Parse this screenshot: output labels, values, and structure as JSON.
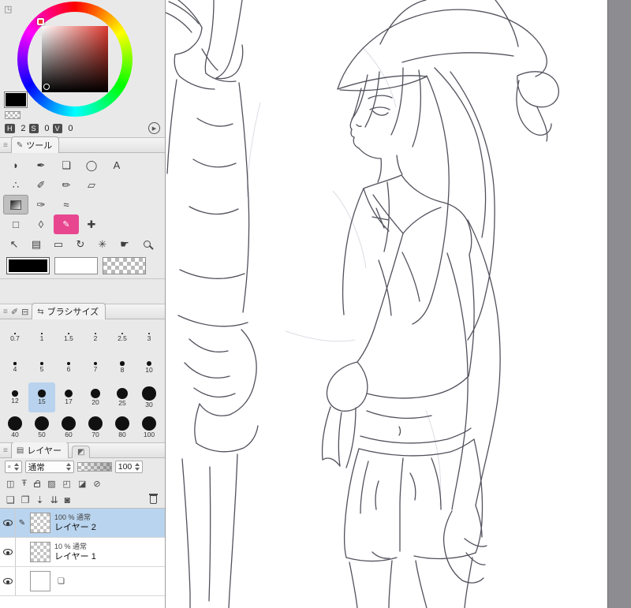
{
  "colors": {
    "accent_pink": "#e8468f",
    "selection_blue": "#b9d3ee",
    "panel_bg": "#e9e9e9",
    "canvas_stroke": "#43434f",
    "right_strip": "#8c8c91",
    "foreground_color": "#000000",
    "background_color": "#ffffff",
    "picked_hue": "#e8372b"
  },
  "color_panel": {
    "hue_label": "H",
    "hue_value": "2",
    "sat_label": "S",
    "sat_value": "0",
    "val_label": "V",
    "val_value": "0"
  },
  "tool_panel": {
    "tab_label": "ツール",
    "tools": [
      {
        "name": "blob-brush",
        "glyph": "◗"
      },
      {
        "name": "dip-pen",
        "glyph": "✒"
      },
      {
        "name": "balloon",
        "glyph": "❏"
      },
      {
        "name": "ellipse-select",
        "glyph": "◯"
      },
      {
        "name": "text",
        "glyph": "A"
      },
      {
        "name": "airbrush",
        "glyph": "∴"
      },
      {
        "name": "marker",
        "glyph": "✐"
      },
      {
        "name": "pencil",
        "glyph": "✏"
      },
      {
        "name": "eraser",
        "glyph": "▱"
      },
      {
        "name": "gradient",
        "glyph": ""
      },
      {
        "name": "brush",
        "glyph": "✑"
      },
      {
        "name": "blend",
        "glyph": "≈"
      },
      {
        "name": "figure",
        "glyph": "□"
      },
      {
        "name": "droplet",
        "glyph": "◊"
      },
      {
        "name": "decoration",
        "glyph": "✎"
      },
      {
        "name": "move",
        "glyph": "✚"
      },
      {
        "name": "object",
        "glyph": "↖"
      },
      {
        "name": "gradient-map",
        "glyph": "▤"
      },
      {
        "name": "canvas-size",
        "glyph": "▭"
      },
      {
        "name": "rotate",
        "glyph": "↻"
      },
      {
        "name": "sparkle",
        "glyph": "✳"
      },
      {
        "name": "hand",
        "glyph": "☛"
      },
      {
        "name": "zoom",
        "glyph": ""
      }
    ]
  },
  "brush_panel": {
    "tab_label": "ブラシサイズ",
    "selected_index": 13,
    "sizes": [
      {
        "label": "0.7",
        "value": 0.7
      },
      {
        "label": "1",
        "value": 1
      },
      {
        "label": "1.5",
        "value": 1.5
      },
      {
        "label": "2",
        "value": 2
      },
      {
        "label": "2.5",
        "value": 2.5
      },
      {
        "label": "3",
        "value": 3
      },
      {
        "label": "4",
        "value": 4
      },
      {
        "label": "5",
        "value": 5
      },
      {
        "label": "6",
        "value": 6
      },
      {
        "label": "7",
        "value": 7
      },
      {
        "label": "8",
        "value": 8
      },
      {
        "label": "10",
        "value": 10
      },
      {
        "label": "12",
        "value": 12
      },
      {
        "label": "15",
        "value": 15
      },
      {
        "label": "17",
        "value": 17
      },
      {
        "label": "20",
        "value": 20
      },
      {
        "label": "25",
        "value": 25
      },
      {
        "label": "30",
        "value": 30
      },
      {
        "label": "40",
        "value": 40
      },
      {
        "label": "50",
        "value": 50
      },
      {
        "label": "60",
        "value": 60
      },
      {
        "label": "70",
        "value": 70
      },
      {
        "label": "80",
        "value": 80
      },
      {
        "label": "100",
        "value": 100
      }
    ]
  },
  "layer_panel": {
    "tab_label": "レイヤー",
    "blend_mode": "通常",
    "opacity_value": "100",
    "layers": [
      {
        "info": "100 % 通常",
        "name": "レイヤー 2",
        "selected": true
      },
      {
        "info": "10 % 通常",
        "name": "レイヤー 1",
        "selected": false
      }
    ]
  }
}
